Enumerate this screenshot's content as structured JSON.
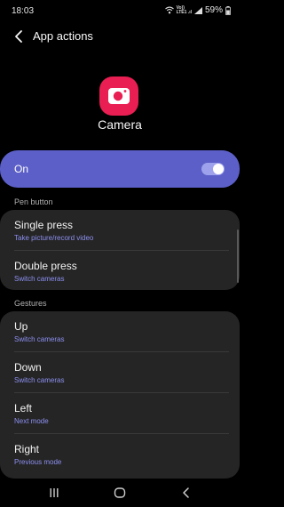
{
  "status_bar": {
    "time": "18:03",
    "network_label": "Vo))\nLTE1 .ıl",
    "battery_percent": "59%",
    "icons": [
      "wifi-icon",
      "signal-icon",
      "battery-icon"
    ]
  },
  "app_bar": {
    "title": "App actions"
  },
  "app": {
    "name": "Camera",
    "icon": "camera-icon",
    "icon_color": "#e91e52"
  },
  "master_switch": {
    "label": "On",
    "enabled": true,
    "accent": "#5b5fc7"
  },
  "pen_button": {
    "header": "Pen button",
    "items": [
      {
        "title": "Single press",
        "subtitle": "Take picture/record video"
      },
      {
        "title": "Double press",
        "subtitle": "Switch cameras"
      }
    ]
  },
  "gestures": {
    "header": "Gestures",
    "items": [
      {
        "title": "Up",
        "subtitle": "Switch cameras"
      },
      {
        "title": "Down",
        "subtitle": "Switch cameras"
      },
      {
        "title": "Left",
        "subtitle": "Next mode"
      },
      {
        "title": "Right",
        "subtitle": "Previous mode"
      }
    ]
  },
  "nav_bar": {
    "buttons": [
      "recents-icon",
      "home-icon",
      "back-icon"
    ]
  }
}
